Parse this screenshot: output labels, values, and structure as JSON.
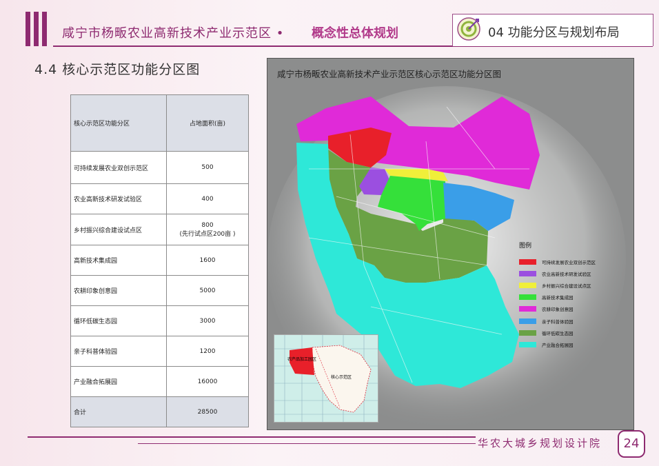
{
  "header": {
    "title": "咸宁市杨畈农业高新技术产业示范区 •",
    "subtitle": "概念性总体规划",
    "section": "04 功能分区与规划布局",
    "accent_color": "#8e2a70"
  },
  "page_subtitle": "4.4 核心示范区功能分区图",
  "table": {
    "headers": [
      "核心示范区功能分区",
      "占地面积(亩)"
    ],
    "rows": [
      {
        "zone": "可持续发展农业双创示范区",
        "area": "500"
      },
      {
        "zone": "农业高新技术研发试验区",
        "area": "400"
      },
      {
        "zone": "乡村振兴综合建设试点区",
        "area": "800",
        "area_note": "(先行试点区200亩 )"
      },
      {
        "zone": "高新技术集成园",
        "area": "1600"
      },
      {
        "zone": "农耕印象创意园",
        "area": "5000"
      },
      {
        "zone": "循环低碳生态园",
        "area": "3000"
      },
      {
        "zone": "亲子科普体验园",
        "area": "1200"
      },
      {
        "zone": "产业融合拓展园",
        "area": "16000"
      }
    ],
    "total": {
      "zone": "合计",
      "area": "28500"
    }
  },
  "map": {
    "title": "咸宁市杨畈农业高新技术产业示范区核心示范区功能分区图",
    "legend_title": "图例",
    "legend": [
      {
        "label": "可持续发展农业双创示范区",
        "color": "#e8202a"
      },
      {
        "label": "农业高新技术研发试验区",
        "color": "#9b4fe0"
      },
      {
        "label": "乡村振兴综合建设试点区",
        "color": "#f0ef3a"
      },
      {
        "label": "高新技术集成园",
        "color": "#35e03a"
      },
      {
        "label": "农耕印象创意园",
        "color": "#e02ad8"
      },
      {
        "label": "亲子科普体验园",
        "color": "#3a9ee8"
      },
      {
        "label": "循环低碳生态园",
        "color": "#6aa245"
      },
      {
        "label": "产业融合拓展园",
        "color": "#2ee8d8"
      }
    ],
    "inset_labels": {
      "a": "农产品加工园区",
      "b": "核心示范区"
    }
  },
  "footer": {
    "org": "华农大城乡规划设计院",
    "page": "24"
  }
}
